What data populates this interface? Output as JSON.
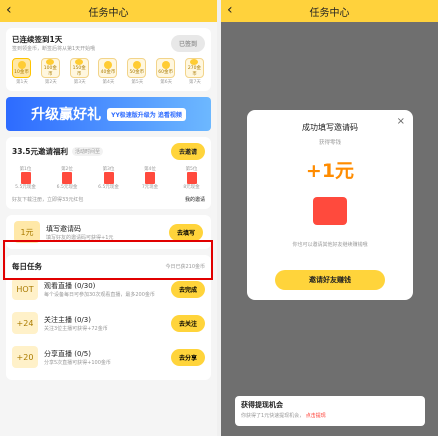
{
  "left": {
    "title": "任务中心",
    "streak": {
      "label": "已连续签到1天",
      "desc": "签到领金币，断签后将从第1天开始哦",
      "button": "已签到",
      "days": [
        {
          "coin": "10金币",
          "day": "第1天"
        },
        {
          "coin": "100金币",
          "day": "第2天"
        },
        {
          "coin": "150金币",
          "day": "第3天"
        },
        {
          "coin": "40金币",
          "day": "第4天"
        },
        {
          "coin": "50金币",
          "day": "第5天"
        },
        {
          "coin": "60金币",
          "day": "第6天"
        },
        {
          "coin": "270金币",
          "day": "第7天"
        }
      ]
    },
    "banner": {
      "text": "升级赢好礼",
      "sub": "YY极速版升级为 追看视频"
    },
    "invite": {
      "title": "33.5元邀请福利",
      "date": "活动时间至",
      "button": "去邀请",
      "milestones": [
        {
          "label": "第1位",
          "amt": "5.5元现金"
        },
        {
          "label": "第2位",
          "amt": "6.5元现金"
        },
        {
          "label": "第3位",
          "amt": "6.5元现金"
        },
        {
          "label": "第4位",
          "amt": "7元现金"
        },
        {
          "label": "第5位",
          "amt": "8元现金"
        }
      ],
      "foot": "好友下载注册，立即得33元红包",
      "myinvite": "我的邀请"
    },
    "fillcode": {
      "title": "填写邀请码",
      "desc": "填写好友的邀请码可获得+1元",
      "badge": "1元",
      "button": "去填写"
    },
    "daily": {
      "title": "每日任务",
      "right": "今日已获210金币",
      "tasks": [
        {
          "name": "观看直播 (0/30)",
          "desc": "每个设备每日可参加30次观看直播，最多200金币",
          "button": "去完成",
          "badge": "HOT"
        },
        {
          "name": "关注主播 (0/3)",
          "desc": "关注3位主播可获得+72金币",
          "button": "去关注",
          "badge": "+24"
        },
        {
          "name": "分享直播 (0/5)",
          "desc": "分享5次直播可获得+100金币",
          "button": "去分享",
          "badge": "+20"
        }
      ]
    }
  },
  "right": {
    "title": "任务中心",
    "modal": {
      "title": "成功填写邀请码",
      "sub": "获得零钱",
      "amount": "+1元",
      "note": "你也可以邀请其他好友继续赚钱哦",
      "button": "邀请好友赚钱"
    },
    "toast": {
      "title": "获得提现机会",
      "msg": "你获得了1元快速提现机会，",
      "link": "点击提现"
    }
  }
}
